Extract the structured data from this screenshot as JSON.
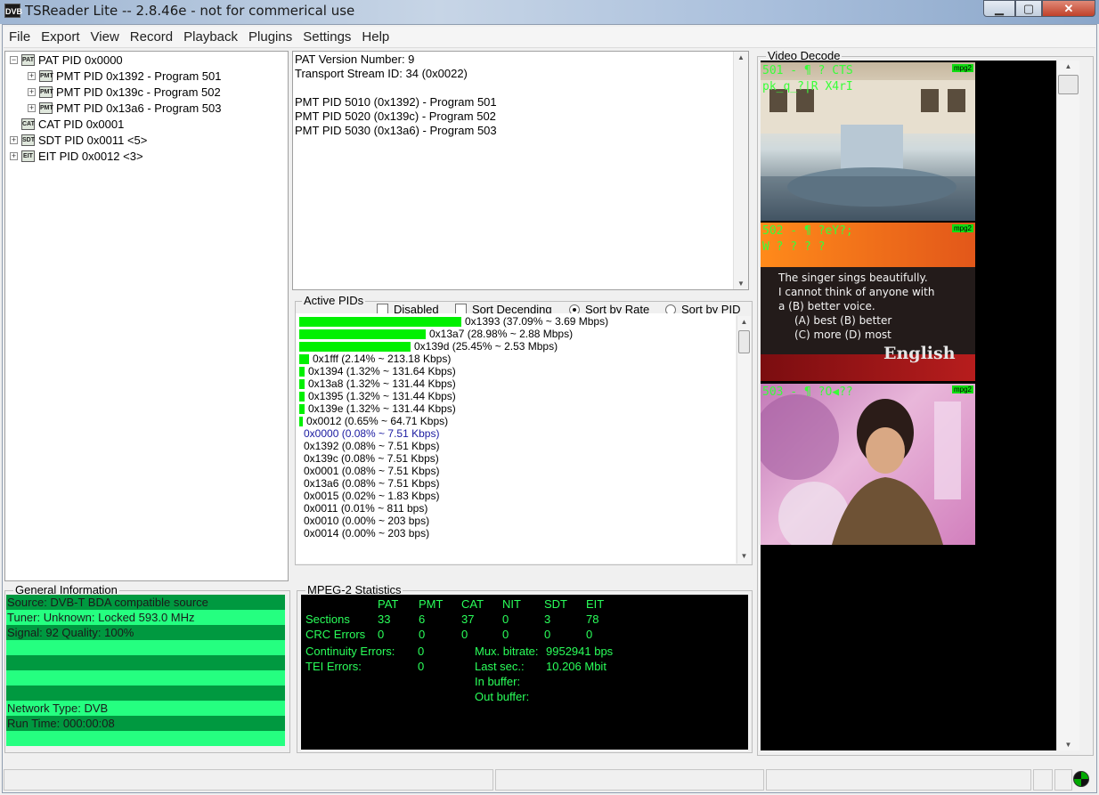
{
  "window": {
    "title": "TSReader Lite -- 2.8.46e - not for commerical use",
    "app_icon": "DVB"
  },
  "menu": [
    "File",
    "Export",
    "View",
    "Record",
    "Playback",
    "Plugins",
    "Settings",
    "Help"
  ],
  "tree": [
    {
      "label": "PAT PID 0x0000",
      "expander": "−",
      "icon": "PAT",
      "indent": 0
    },
    {
      "label": "PMT PID 0x1392 - Program 501",
      "expander": "+",
      "icon": "PMT",
      "indent": 1
    },
    {
      "label": "PMT PID 0x139c - Program 502",
      "expander": "+",
      "icon": "PMT",
      "indent": 1
    },
    {
      "label": "PMT PID 0x13a6 - Program 503",
      "expander": "+",
      "icon": "PMT",
      "indent": 1
    },
    {
      "label": "CAT PID 0x0001",
      "expander": "",
      "icon": "CAT",
      "indent": 0
    },
    {
      "label": "SDT PID 0x0011 <5>",
      "expander": "+",
      "icon": "SDT",
      "indent": 0
    },
    {
      "label": "EIT PID 0x0012 <3>",
      "expander": "+",
      "icon": "EIT",
      "indent": 0
    }
  ],
  "info_lines": [
    "PAT Version Number: 9",
    "Transport Stream ID: 34 (0x0022)",
    "",
    "PMT PID 5010 (0x1392) - Program 501",
    "PMT PID 5020 (0x139c) - Program 502",
    "PMT PID 5030 (0x13a6) - Program 503"
  ],
  "active_pids": {
    "title": "Active PIDs",
    "options": {
      "disabled": {
        "label": "Disabled",
        "checked": false
      },
      "sort_descending": {
        "label": "Sort Decending",
        "checked": false
      },
      "sort_by_rate": {
        "label": "Sort by Rate",
        "selected": true
      },
      "sort_by_pid": {
        "label": "Sort by PID",
        "selected": false
      }
    },
    "rows": [
      {
        "text": "0x1393 (37.09% ~ 3.69 Mbps)",
        "share": 37.09
      },
      {
        "text": "0x13a7 (28.98% ~ 2.88 Mbps)",
        "share": 28.98
      },
      {
        "text": "0x139d (25.45% ~ 2.53 Mbps)",
        "share": 25.45
      },
      {
        "text": "0x1fff (2.14% ~ 213.18 Kbps)",
        "share": 2.14
      },
      {
        "text": "0x1394 (1.32% ~ 131.64 Kbps)",
        "share": 1.32
      },
      {
        "text": "0x13a8 (1.32% ~ 131.44 Kbps)",
        "share": 1.32
      },
      {
        "text": "0x1395 (1.32% ~ 131.44 Kbps)",
        "share": 1.32
      },
      {
        "text": "0x139e (1.32% ~ 131.44 Kbps)",
        "share": 1.32
      },
      {
        "text": "0x0012 (0.65% ~ 64.71 Kbps)",
        "share": 0.65
      },
      {
        "text": "0x0000 (0.08% ~ 7.51 Kbps)",
        "share": 0.08,
        "highlight": true
      },
      {
        "text": "0x1392 (0.08% ~ 7.51 Kbps)",
        "share": 0.08
      },
      {
        "text": "0x139c (0.08% ~ 7.51 Kbps)",
        "share": 0.08
      },
      {
        "text": "0x0001 (0.08% ~ 7.51 Kbps)",
        "share": 0.08
      },
      {
        "text": "0x13a6 (0.08% ~ 7.51 Kbps)",
        "share": 0.08
      },
      {
        "text": "0x0015 (0.02% ~ 1.83 Kbps)",
        "share": 0.02
      },
      {
        "text": "0x0011 (0.01% ~ 811 bps)",
        "share": 0.01
      },
      {
        "text": "0x0010 (0.00% ~ 203 bps)",
        "share": 0.0
      },
      {
        "text": "0x0014 (0.00% ~ 203 bps)",
        "share": 0.0
      }
    ]
  },
  "general_info": {
    "title": "General Information",
    "source": "Source: DVB-T BDA compatible source",
    "tuner": "Tuner: Unknown: Locked 593.0 MHz",
    "signal": "Signal: 92 Quality: 100%",
    "network_type": "Network Type: DVB",
    "run_time": "Run Time: 000:00:08"
  },
  "mpeg_stats": {
    "title": "MPEG-2 Statistics",
    "headers": [
      "PAT",
      "PMT",
      "CAT",
      "NIT",
      "SDT",
      "EIT"
    ],
    "sections_label": "Sections",
    "sections": [
      "33",
      "6",
      "37",
      "0",
      "3",
      "78"
    ],
    "crc_label": "CRC Errors",
    "crc": [
      "0",
      "0",
      "0",
      "0",
      "0",
      "0"
    ],
    "continuity_label": "Continuity Errors:",
    "continuity": "0",
    "tei_label": "TEI Errors:",
    "tei": "0",
    "mux_label": "Mux. bitrate:",
    "mux": "9952941 bps",
    "last_label": "Last sec.:",
    "last": "10.206 Mbit",
    "in_buffer_label": "In buffer:",
    "out_buffer_label": "Out buffer:"
  },
  "video": {
    "title": "Video Decode",
    "thumbs": [
      {
        "osd1": "501 - ¶   ? CTS",
        "osd2": "pk_q_?|R X4rI",
        "codec": "mpg2"
      },
      {
        "osd1": "502 - ¶   ?eY?;",
        "osd2": "W    ? ? ?    ?",
        "codec": "mpg2",
        "quiz": [
          "The singer sings beautifully.",
          "I cannot think of anyone with",
          "a (B) better  voice.",
          "(A) best      (B) better",
          "(C) more      (D) most"
        ],
        "brand": "English"
      },
      {
        "osd1": "503 - ¶   ?O◀??",
        "osd2": "",
        "codec": "mpg2"
      }
    ]
  },
  "colors": {
    "bar": "#00f000",
    "gi_dark": "#009940",
    "gi_light": "#25ff80",
    "stats_text": "#2aff5a"
  }
}
